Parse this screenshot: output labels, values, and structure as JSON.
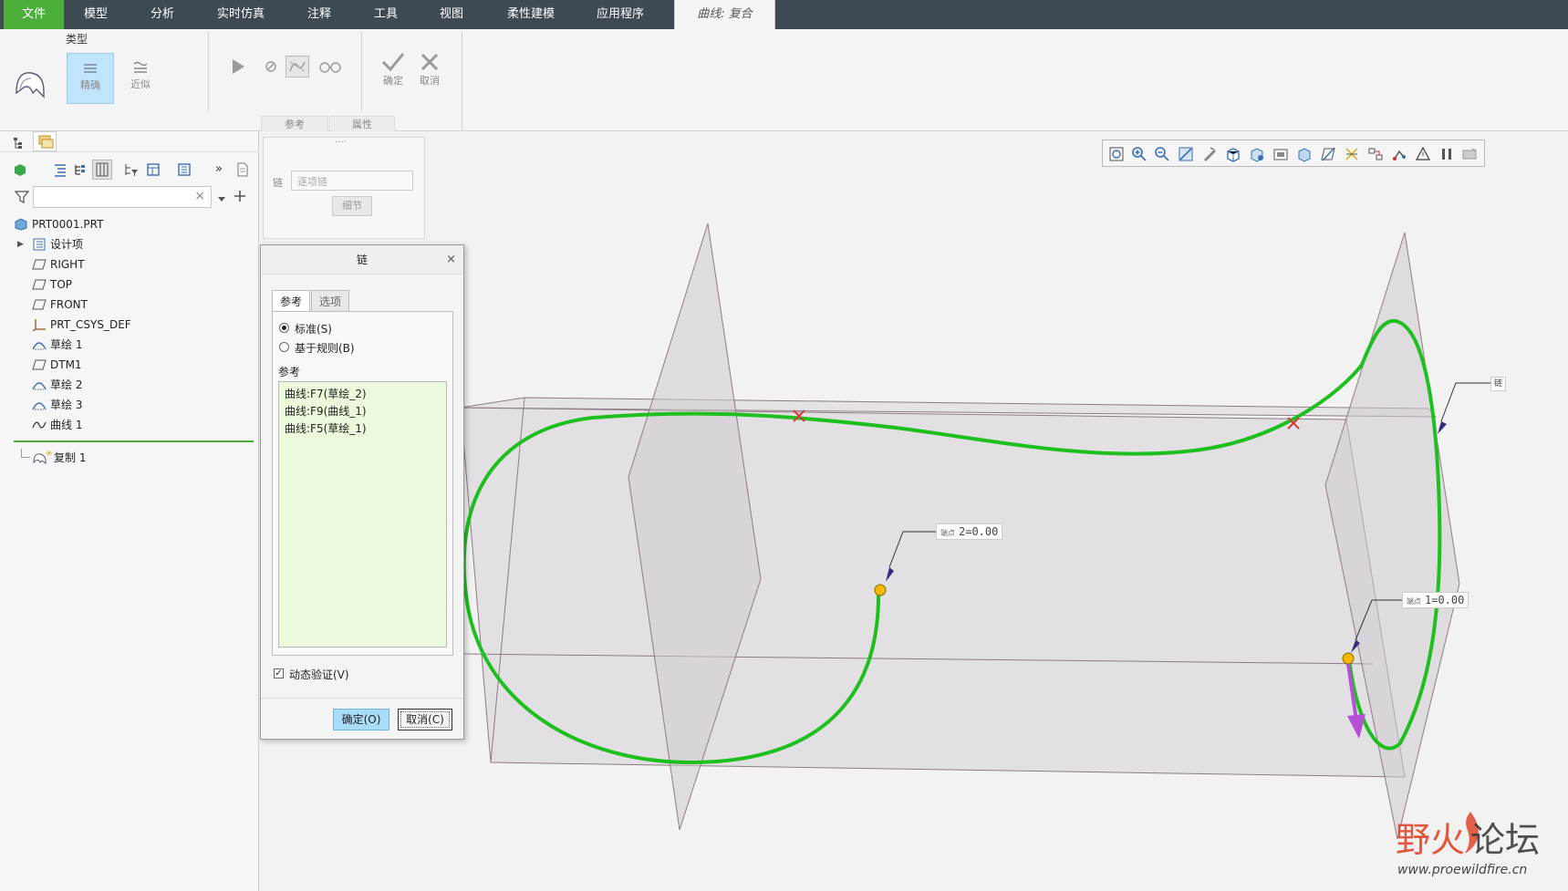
{
  "menubar": {
    "items": [
      "文件",
      "模型",
      "分析",
      "实时仿真",
      "注释",
      "工具",
      "视图",
      "柔性建模",
      "应用程序"
    ],
    "context_tab": "曲线: 复合"
  },
  "ribbon": {
    "type_group_label": "类型",
    "exact_label": "精确",
    "approx_label": "近似",
    "ok_label": "确定",
    "cancel_label": "取消",
    "subtab_refs": "参考",
    "subtab_props": "属性"
  },
  "model_tree": {
    "items": [
      {
        "label": "PRT0001.PRT",
        "icon": "part-icon"
      },
      {
        "label": "设计项",
        "icon": "design-items-icon"
      },
      {
        "label": "RIGHT",
        "icon": "datum-plane-icon"
      },
      {
        "label": "TOP",
        "icon": "datum-plane-icon"
      },
      {
        "label": "FRONT",
        "icon": "datum-plane-icon"
      },
      {
        "label": "PRT_CSYS_DEF",
        "icon": "csys-icon"
      },
      {
        "label": "草绘 1",
        "icon": "sketch-icon"
      },
      {
        "label": "DTM1",
        "icon": "datum-plane-icon"
      },
      {
        "label": "草绘 2",
        "icon": "sketch-icon"
      },
      {
        "label": "草绘 3",
        "icon": "sketch-icon"
      },
      {
        "label": "曲线 1",
        "icon": "curve-icon"
      },
      {
        "label": "复制 1",
        "icon": "copy-feature-icon"
      }
    ]
  },
  "ref_panel": {
    "chain_label": "链",
    "chain_placeholder": "逐项链",
    "details_button": "细节",
    "dots": "····"
  },
  "chain_dialog": {
    "title": "链",
    "close": "×",
    "tab_refs": "参考",
    "tab_options": "选项",
    "radio_standard": "标准(S)",
    "radio_rule": "基于规则(B)",
    "refs_label": "参考",
    "references": [
      "曲线:F7(草绘_2)",
      "曲线:F9(曲线_1)",
      "曲线:F5(草绘_1)"
    ],
    "dynamic_verify": "动态验证(V)",
    "ok_button": "确定(O)",
    "cancel_button": "取消(C)"
  },
  "viewport": {
    "callout_chain": "链",
    "callout_end2_tag": "端点",
    "callout_end2_value": "2=0.00",
    "callout_end1_tag": "端点",
    "callout_end1_value": "1=0.00"
  },
  "watermark": {
    "text": "野火论坛",
    "url": "www.proewildfire.cn"
  },
  "colors": {
    "curve": "#1fbf1f",
    "accent_green": "#4caf3a",
    "menubar": "#3d4a52",
    "reference_list_bg": "#eafadb",
    "direction_arrow": "#b44fd6",
    "endpoint": "#f5b800"
  }
}
